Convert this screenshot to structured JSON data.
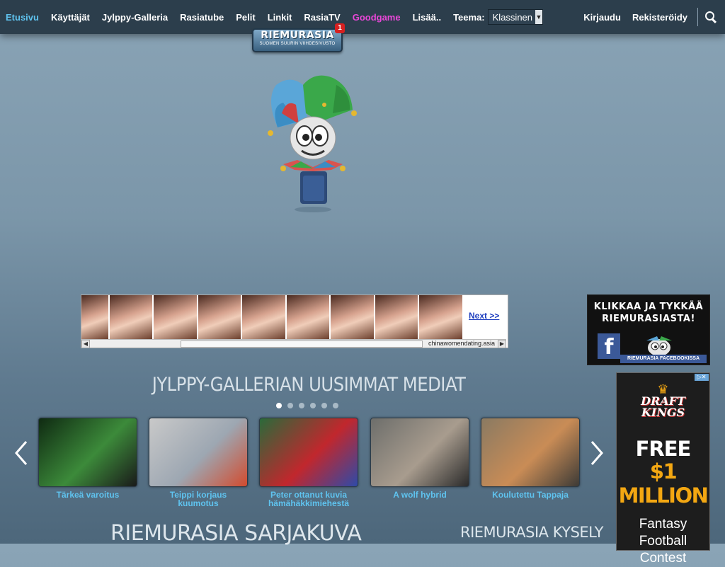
{
  "nav": {
    "items": [
      {
        "label": "Etusivu",
        "active": true
      },
      {
        "label": "Käyttäjät"
      },
      {
        "label": "Jylppy-Galleria"
      },
      {
        "label": "Rasiatube"
      },
      {
        "label": "Pelit"
      },
      {
        "label": "Linkit"
      },
      {
        "label": "RasiaTV"
      },
      {
        "label": "Goodgame",
        "color": "#e947d8"
      },
      {
        "label": "Lisää.."
      }
    ],
    "theme_label": "Teema:",
    "theme_value": "Klassinen",
    "login": "Kirjaudu",
    "register": "Rekisteröidy",
    "search_icon": "search-icon"
  },
  "logo": {
    "title": "RIEMURASIA",
    "tagline": "SUOMEN SUURIN VIIHDESIVUSTO",
    "badge": "1"
  },
  "ad_banner": {
    "next": "Next >>",
    "source": "chinawomendating.asia"
  },
  "facebook_box": {
    "line1": "KLIKKAA JA TYKKÄÄ",
    "line2": "RIEMURASIASTA!",
    "logo_letter": "f",
    "footer": "RIEMURASIA FACEBOOKISSA"
  },
  "draftkings_ad": {
    "brand_top": "DRAFT",
    "brand_bottom": "KINGS",
    "line1": "FREE",
    "line2": "$1 MILLION",
    "line3": "Fantasy",
    "line4": "Football",
    "line5": "Contest"
  },
  "gallery": {
    "title": "JYLPPY-GALLERIAN UUSIMMAT MEDIAT",
    "dots": 6,
    "active_dot": 0,
    "items": [
      {
        "caption": "Tärkeä varoitus",
        "colors": [
          "#0f2a12",
          "#3c8a3a",
          "#1a1a1a"
        ]
      },
      {
        "caption": "Teippi korjaus kuumotus",
        "colors": [
          "#c9c9c9",
          "#9da7b2",
          "#d24b2e"
        ]
      },
      {
        "caption": "Peter ottanut kuvia hämähäkkimiehestä",
        "colors": [
          "#2a6a3a",
          "#c1272d",
          "#2e4aa8"
        ]
      },
      {
        "caption": "A wolf hybrid",
        "colors": [
          "#6d6e6b",
          "#a89c8e",
          "#2a2a2a"
        ]
      },
      {
        "caption": "Koulutettu Tappaja",
        "colors": [
          "#8a7a62",
          "#c98c56",
          "#3c3a36"
        ]
      }
    ]
  },
  "sections": {
    "comic": "RIEMURASIA SARJAKUVA",
    "poll": "RIEMURASIA KYSELY"
  }
}
